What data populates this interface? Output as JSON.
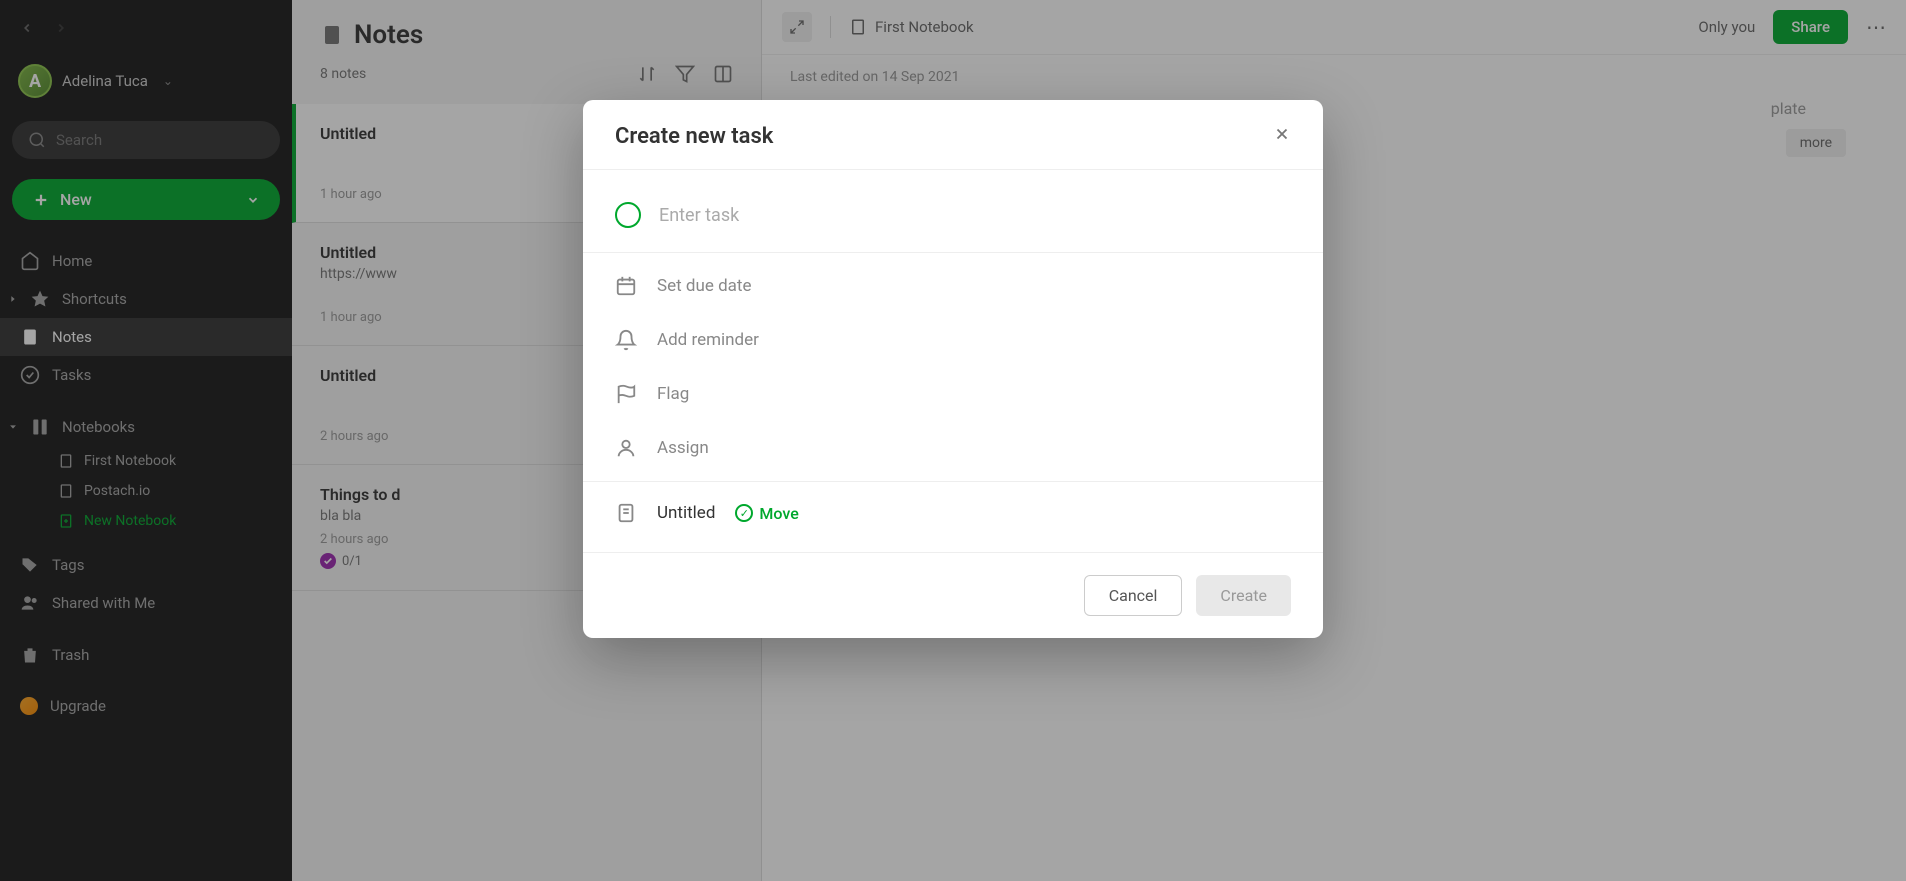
{
  "user": {
    "name": "Adelina Tuca",
    "initial": "A"
  },
  "search": {
    "placeholder": "Search"
  },
  "newButton": {
    "label": "New"
  },
  "sidebar": {
    "home": "Home",
    "shortcuts": "Shortcuts",
    "notes": "Notes",
    "tasks": "Tasks",
    "notebooks": "Notebooks",
    "notebookItems": [
      "First Notebook",
      "Postach.io",
      "New Notebook"
    ],
    "tags": "Tags",
    "shared": "Shared with Me",
    "trash": "Trash",
    "upgrade": "Upgrade"
  },
  "notesPanel": {
    "title": "Notes",
    "count": "8 notes",
    "items": [
      {
        "title": "Untitled",
        "preview": "",
        "time": "1 hour ago",
        "badge": null
      },
      {
        "title": "Untitled",
        "preview": "https://www",
        "time": "1 hour ago",
        "badge": null
      },
      {
        "title": "Untitled",
        "preview": "",
        "time": "2 hours ago",
        "badge": null
      },
      {
        "title": "Things to d",
        "preview": "bla bla",
        "time": "2 hours ago",
        "badge": "0/1"
      }
    ]
  },
  "editor": {
    "notebook": "First Notebook",
    "onlyYou": "Only you",
    "share": "Share",
    "lastEdited": "Last edited on 14 Sep 2021",
    "templateHint": "plate",
    "moreHint": "more"
  },
  "modal": {
    "title": "Create new task",
    "taskPlaceholder": "Enter task",
    "dueDate": "Set due date",
    "reminder": "Add reminder",
    "flag": "Flag",
    "assign": "Assign",
    "noteRef": "Untitled",
    "move": "Move",
    "cancel": "Cancel",
    "create": "Create"
  }
}
